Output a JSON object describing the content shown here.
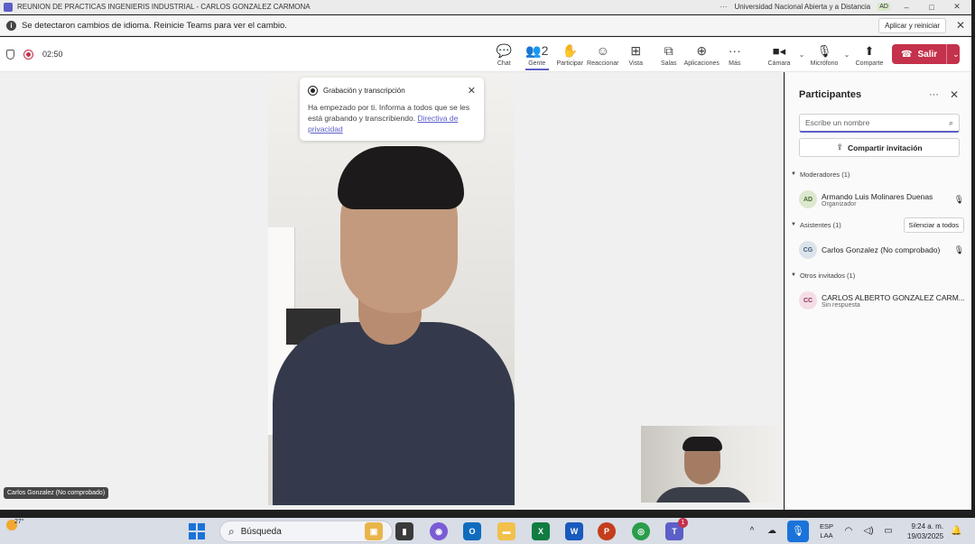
{
  "window": {
    "title": "REUNION DE PRACTICAS INGENIERIS INDUSTRIAL - CARLOS GONZALEZ CARMONA",
    "org": "Universidad Nacional Abierta y a Distancia",
    "org_badge": "AD",
    "more": "···",
    "min": "–",
    "max": "□",
    "close": "✕"
  },
  "notice": {
    "message": "Se detectaron cambios de idioma. Reinicie Teams para ver el cambio.",
    "apply_label": "Aplicar y reiniciar",
    "info_glyph": "i",
    "close": "✕"
  },
  "toolbar": {
    "timer": "02:50",
    "tools": [
      {
        "label": "Chat",
        "icon": "chat-icon",
        "glyph": "💬"
      },
      {
        "label": "Gente",
        "icon": "people-icon",
        "glyph": "👥2",
        "active": true
      },
      {
        "label": "Participar",
        "icon": "raise-hand-icon",
        "glyph": "✋"
      },
      {
        "label": "Reaccionar",
        "icon": "emoji-icon",
        "glyph": "☺"
      },
      {
        "label": "Vista",
        "icon": "grid-view-icon",
        "glyph": "⊞"
      },
      {
        "label": "Salas",
        "icon": "rooms-icon",
        "glyph": "⧉"
      },
      {
        "label": "Aplicaciones",
        "icon": "apps-icon",
        "glyph": "⊕"
      },
      {
        "label": "Más",
        "icon": "more-icon",
        "glyph": "···"
      }
    ],
    "camera_label": "Cámara",
    "mic_label": "Micrófono",
    "share_label": "Comparte",
    "leave_label": "Salir",
    "caret": "⌄"
  },
  "recording_card": {
    "title": "Grabación y transcripción",
    "body": "Ha empezado por ti. Informa a todos que se les está grabando y transcribiendo.",
    "link": "Directiva de privacidad",
    "close": "✕"
  },
  "main_video": {
    "name_tag": "Carlos Gonzalez (No comprobado)"
  },
  "participants": {
    "title": "Participantes",
    "more": "···",
    "close": "✕",
    "search_placeholder": "Escribe un nombre",
    "share_invite": "Compartir invitación",
    "sections": {
      "moderators": "Moderadores (1)",
      "attendees": "Asistentes (1)",
      "others": "Otros invitados (1)",
      "mute_all": "Silenciar a todos"
    },
    "people": [
      {
        "initials": "AD",
        "name": "Armando Luis Molinares Duenas",
        "sub": "Organizador",
        "avatar_bg": "#dce8cf",
        "avatar_fg": "#4a6b2c"
      },
      {
        "initials": "CG",
        "name": "Carlos Gonzalez (No comprobado)",
        "sub": "",
        "avatar_bg": "#dde3ea",
        "avatar_fg": "#3c5a78"
      },
      {
        "initials": "CC",
        "name": "CARLOS ALBERTO GONZALEZ CARM...",
        "sub": "Sin respuesta",
        "avatar_bg": "#f4dde6",
        "avatar_fg": "#8a3556"
      }
    ]
  },
  "taskbar": {
    "temperature": "27°",
    "search_label": "Búsqueda",
    "lang_top": "ESP",
    "lang_bottom": "LAA",
    "time": "9:24 a. m.",
    "date": "19/03/2025",
    "teams_badge": "1"
  },
  "colors": {
    "accent": "#5b5fc7",
    "leave": "#c4314b",
    "windows_blue": "#1a73d9"
  }
}
